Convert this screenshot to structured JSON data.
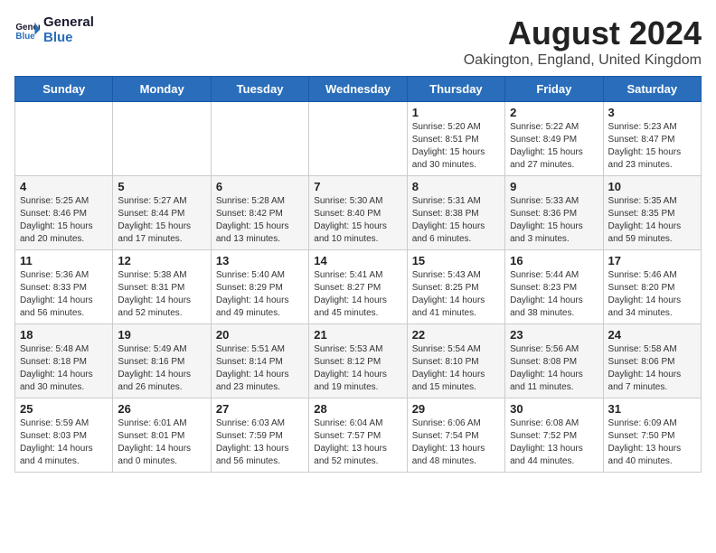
{
  "header": {
    "logo_line1": "General",
    "logo_line2": "Blue",
    "month_year": "August 2024",
    "location": "Oakington, England, United Kingdom"
  },
  "weekdays": [
    "Sunday",
    "Monday",
    "Tuesday",
    "Wednesday",
    "Thursday",
    "Friday",
    "Saturday"
  ],
  "weeks": [
    [
      {
        "day": "",
        "content": ""
      },
      {
        "day": "",
        "content": ""
      },
      {
        "day": "",
        "content": ""
      },
      {
        "day": "",
        "content": ""
      },
      {
        "day": "1",
        "content": "Sunrise: 5:20 AM\nSunset: 8:51 PM\nDaylight: 15 hours\nand 30 minutes."
      },
      {
        "day": "2",
        "content": "Sunrise: 5:22 AM\nSunset: 8:49 PM\nDaylight: 15 hours\nand 27 minutes."
      },
      {
        "day": "3",
        "content": "Sunrise: 5:23 AM\nSunset: 8:47 PM\nDaylight: 15 hours\nand 23 minutes."
      }
    ],
    [
      {
        "day": "4",
        "content": "Sunrise: 5:25 AM\nSunset: 8:46 PM\nDaylight: 15 hours\nand 20 minutes."
      },
      {
        "day": "5",
        "content": "Sunrise: 5:27 AM\nSunset: 8:44 PM\nDaylight: 15 hours\nand 17 minutes."
      },
      {
        "day": "6",
        "content": "Sunrise: 5:28 AM\nSunset: 8:42 PM\nDaylight: 15 hours\nand 13 minutes."
      },
      {
        "day": "7",
        "content": "Sunrise: 5:30 AM\nSunset: 8:40 PM\nDaylight: 15 hours\nand 10 minutes."
      },
      {
        "day": "8",
        "content": "Sunrise: 5:31 AM\nSunset: 8:38 PM\nDaylight: 15 hours\nand 6 minutes."
      },
      {
        "day": "9",
        "content": "Sunrise: 5:33 AM\nSunset: 8:36 PM\nDaylight: 15 hours\nand 3 minutes."
      },
      {
        "day": "10",
        "content": "Sunrise: 5:35 AM\nSunset: 8:35 PM\nDaylight: 14 hours\nand 59 minutes."
      }
    ],
    [
      {
        "day": "11",
        "content": "Sunrise: 5:36 AM\nSunset: 8:33 PM\nDaylight: 14 hours\nand 56 minutes."
      },
      {
        "day": "12",
        "content": "Sunrise: 5:38 AM\nSunset: 8:31 PM\nDaylight: 14 hours\nand 52 minutes."
      },
      {
        "day": "13",
        "content": "Sunrise: 5:40 AM\nSunset: 8:29 PM\nDaylight: 14 hours\nand 49 minutes."
      },
      {
        "day": "14",
        "content": "Sunrise: 5:41 AM\nSunset: 8:27 PM\nDaylight: 14 hours\nand 45 minutes."
      },
      {
        "day": "15",
        "content": "Sunrise: 5:43 AM\nSunset: 8:25 PM\nDaylight: 14 hours\nand 41 minutes."
      },
      {
        "day": "16",
        "content": "Sunrise: 5:44 AM\nSunset: 8:23 PM\nDaylight: 14 hours\nand 38 minutes."
      },
      {
        "day": "17",
        "content": "Sunrise: 5:46 AM\nSunset: 8:20 PM\nDaylight: 14 hours\nand 34 minutes."
      }
    ],
    [
      {
        "day": "18",
        "content": "Sunrise: 5:48 AM\nSunset: 8:18 PM\nDaylight: 14 hours\nand 30 minutes."
      },
      {
        "day": "19",
        "content": "Sunrise: 5:49 AM\nSunset: 8:16 PM\nDaylight: 14 hours\nand 26 minutes."
      },
      {
        "day": "20",
        "content": "Sunrise: 5:51 AM\nSunset: 8:14 PM\nDaylight: 14 hours\nand 23 minutes."
      },
      {
        "day": "21",
        "content": "Sunrise: 5:53 AM\nSunset: 8:12 PM\nDaylight: 14 hours\nand 19 minutes."
      },
      {
        "day": "22",
        "content": "Sunrise: 5:54 AM\nSunset: 8:10 PM\nDaylight: 14 hours\nand 15 minutes."
      },
      {
        "day": "23",
        "content": "Sunrise: 5:56 AM\nSunset: 8:08 PM\nDaylight: 14 hours\nand 11 minutes."
      },
      {
        "day": "24",
        "content": "Sunrise: 5:58 AM\nSunset: 8:06 PM\nDaylight: 14 hours\nand 7 minutes."
      }
    ],
    [
      {
        "day": "25",
        "content": "Sunrise: 5:59 AM\nSunset: 8:03 PM\nDaylight: 14 hours\nand 4 minutes."
      },
      {
        "day": "26",
        "content": "Sunrise: 6:01 AM\nSunset: 8:01 PM\nDaylight: 14 hours\nand 0 minutes."
      },
      {
        "day": "27",
        "content": "Sunrise: 6:03 AM\nSunset: 7:59 PM\nDaylight: 13 hours\nand 56 minutes."
      },
      {
        "day": "28",
        "content": "Sunrise: 6:04 AM\nSunset: 7:57 PM\nDaylight: 13 hours\nand 52 minutes."
      },
      {
        "day": "29",
        "content": "Sunrise: 6:06 AM\nSunset: 7:54 PM\nDaylight: 13 hours\nand 48 minutes."
      },
      {
        "day": "30",
        "content": "Sunrise: 6:08 AM\nSunset: 7:52 PM\nDaylight: 13 hours\nand 44 minutes."
      },
      {
        "day": "31",
        "content": "Sunrise: 6:09 AM\nSunset: 7:50 PM\nDaylight: 13 hours\nand 40 minutes."
      }
    ]
  ]
}
